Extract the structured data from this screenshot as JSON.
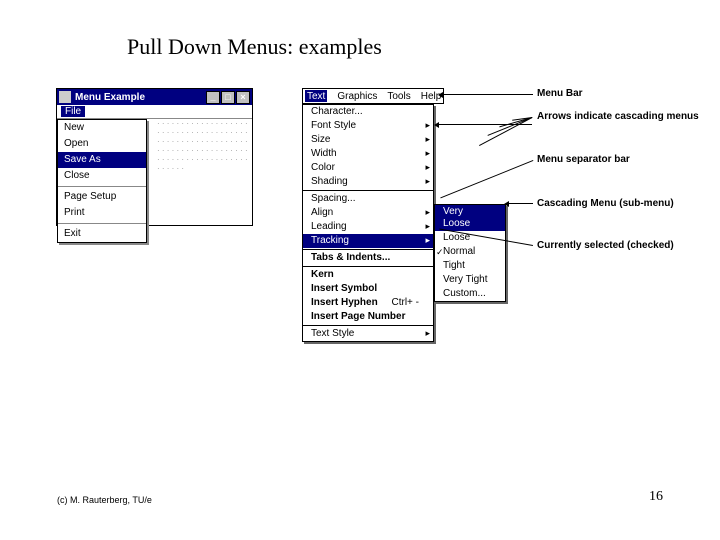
{
  "title": "Pull Down Menus: examples",
  "footer": {
    "left": "(c) M. Rauterberg, TU/e",
    "right": "16"
  },
  "window": {
    "title": "Menu Example",
    "file_label": "File",
    "items": [
      "New",
      "Open",
      "Save As",
      "Close",
      "Page Setup",
      "Print",
      "Exit"
    ]
  },
  "menubar": [
    "Text",
    "Graphics",
    "Tools",
    "Help"
  ],
  "textmenu": {
    "g1": [
      "Character...",
      "Font Style",
      "Size",
      "Width",
      "Color",
      "Shading"
    ],
    "g2": [
      "Spacing...",
      "Align",
      "Leading",
      "Tracking"
    ],
    "g3": [
      {
        "label": "Tabs & Indents..."
      }
    ],
    "g4": [
      {
        "label": "Kern"
      },
      {
        "label": "Insert Symbol"
      },
      {
        "label": "Insert Hyphen",
        "kbd": "Ctrl+ -"
      },
      {
        "label": "Insert Page Number"
      }
    ],
    "g5": [
      "Text Style"
    ]
  },
  "submenu": [
    "Very Loose",
    "Loose",
    "Normal",
    "Tight",
    "Very Tight",
    "Custom..."
  ],
  "annotations": {
    "a1": "Menu Bar",
    "a2": "Arrows indicate cascading menus",
    "a3": "Menu separator bar",
    "a4": "Cascading Menu (sub-menu)",
    "a5": "Currently selected (checked)"
  }
}
